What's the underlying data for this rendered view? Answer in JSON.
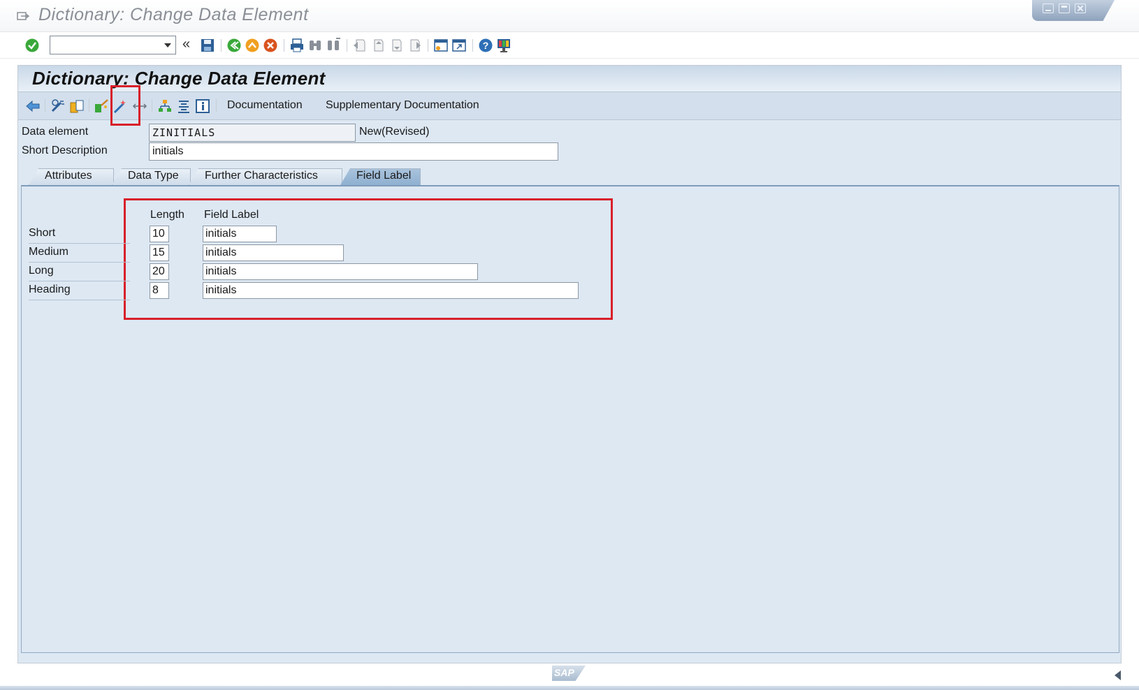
{
  "window": {
    "title": "Dictionary: Change Data Element"
  },
  "system_toolbar": {
    "command_field_value": "",
    "nav_symbol": "«"
  },
  "screen": {
    "title": "Dictionary: Change Data Element"
  },
  "app_toolbar": {
    "documentation_label": "Documentation",
    "supplementary_documentation_label": "Supplementary Documentation"
  },
  "header_fields": {
    "data_element_label": "Data element",
    "data_element_value": "ZINITIALS",
    "status": "New(Revised)",
    "short_description_label": "Short Description",
    "short_description_value": "initials"
  },
  "tabs": [
    {
      "label": "Attributes",
      "active": false
    },
    {
      "label": "Data Type",
      "active": false
    },
    {
      "label": "Further Characteristics",
      "active": false
    },
    {
      "label": "Field Label",
      "active": true
    }
  ],
  "field_label_table": {
    "col_length": "Length",
    "col_field_label": "Field Label",
    "rows": [
      {
        "name": "Short",
        "length": "10",
        "label": "initials"
      },
      {
        "name": "Medium",
        "length": "15",
        "label": "initials"
      },
      {
        "name": "Long",
        "length": "20",
        "label": "initials"
      },
      {
        "name": "Heading",
        "length": "8",
        "label": "initials"
      }
    ]
  },
  "footer": {
    "logo_text": "SAP"
  },
  "colors": {
    "highlight": "#d9202a",
    "frame_bg": "#dde8f3",
    "active_tab": "#8fb0d0"
  }
}
